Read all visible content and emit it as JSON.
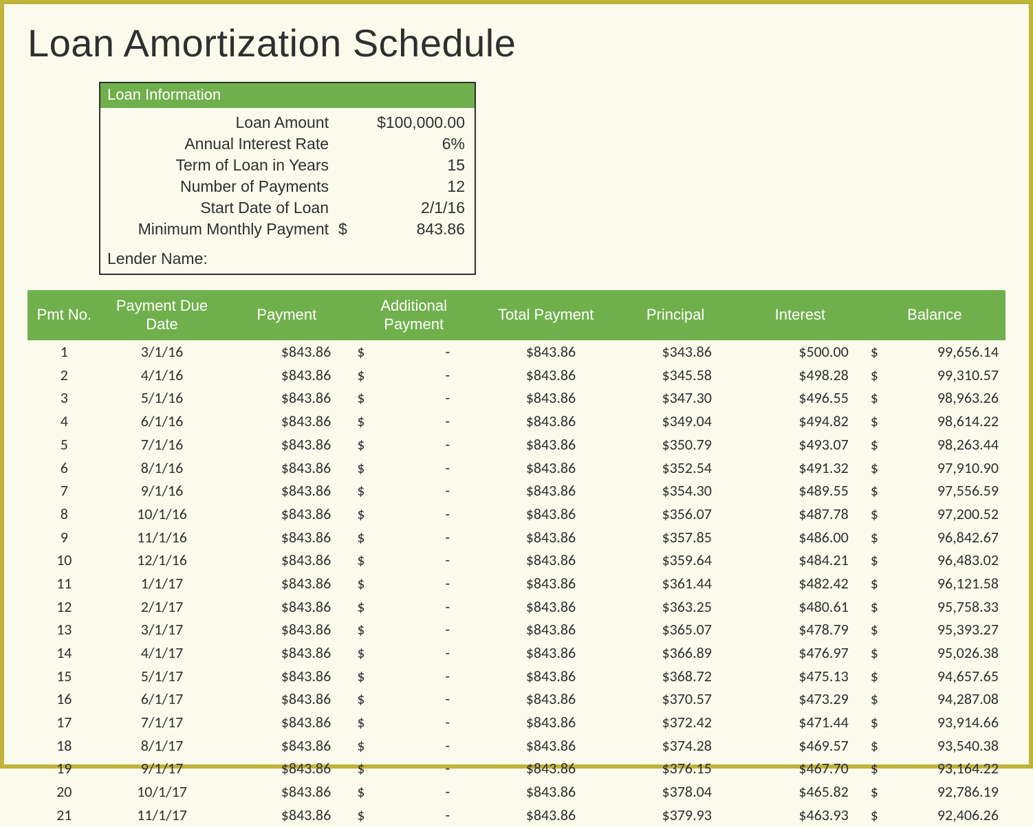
{
  "title": "Loan Amortization Schedule",
  "info": {
    "header": "Loan Information",
    "rows": [
      {
        "label": "Loan Amount",
        "value": "$100,000.00"
      },
      {
        "label": "Annual Interest Rate",
        "value": "6%"
      },
      {
        "label": "Term of Loan in Years",
        "value": "15"
      },
      {
        "label": "Number of Payments",
        "value": "12"
      },
      {
        "label": "Start Date of Loan",
        "value": "2/1/16"
      },
      {
        "label": "Minimum Monthly Payment",
        "sym": "$",
        "amount": "843.86"
      }
    ],
    "lender_label": "Lender Name:"
  },
  "columns": {
    "pmt_no": "Pmt No.",
    "due": "Payment Due Date",
    "payment": "Payment",
    "additional": "Additional Payment",
    "total": "Total Payment",
    "principal": "Principal",
    "interest": "Interest",
    "balance": "Balance"
  },
  "currency_symbol": "$",
  "additional_dash": "-",
  "rows": [
    {
      "no": "1",
      "due": "3/1/16",
      "payment": "$843.86",
      "total": "$843.86",
      "principal": "$343.86",
      "interest": "$500.00",
      "balance": "99,656.14"
    },
    {
      "no": "2",
      "due": "4/1/16",
      "payment": "$843.86",
      "total": "$843.86",
      "principal": "$345.58",
      "interest": "$498.28",
      "balance": "99,310.57"
    },
    {
      "no": "3",
      "due": "5/1/16",
      "payment": "$843.86",
      "total": "$843.86",
      "principal": "$347.30",
      "interest": "$496.55",
      "balance": "98,963.26"
    },
    {
      "no": "4",
      "due": "6/1/16",
      "payment": "$843.86",
      "total": "$843.86",
      "principal": "$349.04",
      "interest": "$494.82",
      "balance": "98,614.22"
    },
    {
      "no": "5",
      "due": "7/1/16",
      "payment": "$843.86",
      "total": "$843.86",
      "principal": "$350.79",
      "interest": "$493.07",
      "balance": "98,263.44"
    },
    {
      "no": "6",
      "due": "8/1/16",
      "payment": "$843.86",
      "total": "$843.86",
      "principal": "$352.54",
      "interest": "$491.32",
      "balance": "97,910.90"
    },
    {
      "no": "7",
      "due": "9/1/16",
      "payment": "$843.86",
      "total": "$843.86",
      "principal": "$354.30",
      "interest": "$489.55",
      "balance": "97,556.59"
    },
    {
      "no": "8",
      "due": "10/1/16",
      "payment": "$843.86",
      "total": "$843.86",
      "principal": "$356.07",
      "interest": "$487.78",
      "balance": "97,200.52"
    },
    {
      "no": "9",
      "due": "11/1/16",
      "payment": "$843.86",
      "total": "$843.86",
      "principal": "$357.85",
      "interest": "$486.00",
      "balance": "96,842.67"
    },
    {
      "no": "10",
      "due": "12/1/16",
      "payment": "$843.86",
      "total": "$843.86",
      "principal": "$359.64",
      "interest": "$484.21",
      "balance": "96,483.02"
    },
    {
      "no": "11",
      "due": "1/1/17",
      "payment": "$843.86",
      "total": "$843.86",
      "principal": "$361.44",
      "interest": "$482.42",
      "balance": "96,121.58"
    },
    {
      "no": "12",
      "due": "2/1/17",
      "payment": "$843.86",
      "total": "$843.86",
      "principal": "$363.25",
      "interest": "$480.61",
      "balance": "95,758.33"
    },
    {
      "no": "13",
      "due": "3/1/17",
      "payment": "$843.86",
      "total": "$843.86",
      "principal": "$365.07",
      "interest": "$478.79",
      "balance": "95,393.27"
    },
    {
      "no": "14",
      "due": "4/1/17",
      "payment": "$843.86",
      "total": "$843.86",
      "principal": "$366.89",
      "interest": "$476.97",
      "balance": "95,026.38"
    },
    {
      "no": "15",
      "due": "5/1/17",
      "payment": "$843.86",
      "total": "$843.86",
      "principal": "$368.72",
      "interest": "$475.13",
      "balance": "94,657.65"
    },
    {
      "no": "16",
      "due": "6/1/17",
      "payment": "$843.86",
      "total": "$843.86",
      "principal": "$370.57",
      "interest": "$473.29",
      "balance": "94,287.08"
    },
    {
      "no": "17",
      "due": "7/1/17",
      "payment": "$843.86",
      "total": "$843.86",
      "principal": "$372.42",
      "interest": "$471.44",
      "balance": "93,914.66"
    },
    {
      "no": "18",
      "due": "8/1/17",
      "payment": "$843.86",
      "total": "$843.86",
      "principal": "$374.28",
      "interest": "$469.57",
      "balance": "93,540.38"
    },
    {
      "no": "19",
      "due": "9/1/17",
      "payment": "$843.86",
      "total": "$843.86",
      "principal": "$376.15",
      "interest": "$467.70",
      "balance": "93,164.22"
    },
    {
      "no": "20",
      "due": "10/1/17",
      "payment": "$843.86",
      "total": "$843.86",
      "principal": "$378.04",
      "interest": "$465.82",
      "balance": "92,786.19"
    },
    {
      "no": "21",
      "due": "11/1/17",
      "payment": "$843.86",
      "total": "$843.86",
      "principal": "$379.93",
      "interest": "$463.93",
      "balance": "92,406.26"
    }
  ]
}
